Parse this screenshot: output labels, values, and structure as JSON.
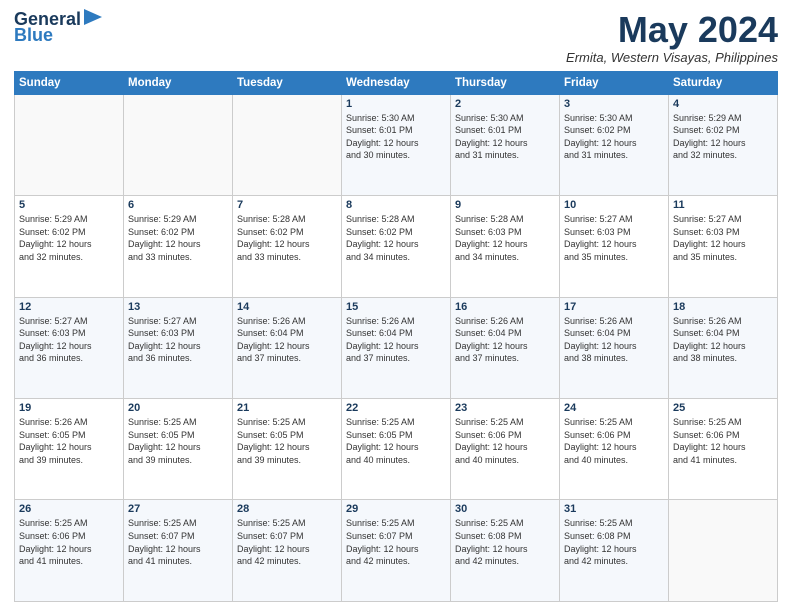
{
  "header": {
    "logo_line1": "General",
    "logo_line2": "Blue",
    "month_title": "May 2024",
    "location": "Ermita, Western Visayas, Philippines"
  },
  "weekdays": [
    "Sunday",
    "Monday",
    "Tuesday",
    "Wednesday",
    "Thursday",
    "Friday",
    "Saturday"
  ],
  "weeks": [
    [
      {
        "day": "",
        "info": ""
      },
      {
        "day": "",
        "info": ""
      },
      {
        "day": "",
        "info": ""
      },
      {
        "day": "1",
        "info": "Sunrise: 5:30 AM\nSunset: 6:01 PM\nDaylight: 12 hours\nand 30 minutes."
      },
      {
        "day": "2",
        "info": "Sunrise: 5:30 AM\nSunset: 6:01 PM\nDaylight: 12 hours\nand 31 minutes."
      },
      {
        "day": "3",
        "info": "Sunrise: 5:30 AM\nSunset: 6:02 PM\nDaylight: 12 hours\nand 31 minutes."
      },
      {
        "day": "4",
        "info": "Sunrise: 5:29 AM\nSunset: 6:02 PM\nDaylight: 12 hours\nand 32 minutes."
      }
    ],
    [
      {
        "day": "5",
        "info": "Sunrise: 5:29 AM\nSunset: 6:02 PM\nDaylight: 12 hours\nand 32 minutes."
      },
      {
        "day": "6",
        "info": "Sunrise: 5:29 AM\nSunset: 6:02 PM\nDaylight: 12 hours\nand 33 minutes."
      },
      {
        "day": "7",
        "info": "Sunrise: 5:28 AM\nSunset: 6:02 PM\nDaylight: 12 hours\nand 33 minutes."
      },
      {
        "day": "8",
        "info": "Sunrise: 5:28 AM\nSunset: 6:02 PM\nDaylight: 12 hours\nand 34 minutes."
      },
      {
        "day": "9",
        "info": "Sunrise: 5:28 AM\nSunset: 6:03 PM\nDaylight: 12 hours\nand 34 minutes."
      },
      {
        "day": "10",
        "info": "Sunrise: 5:27 AM\nSunset: 6:03 PM\nDaylight: 12 hours\nand 35 minutes."
      },
      {
        "day": "11",
        "info": "Sunrise: 5:27 AM\nSunset: 6:03 PM\nDaylight: 12 hours\nand 35 minutes."
      }
    ],
    [
      {
        "day": "12",
        "info": "Sunrise: 5:27 AM\nSunset: 6:03 PM\nDaylight: 12 hours\nand 36 minutes."
      },
      {
        "day": "13",
        "info": "Sunrise: 5:27 AM\nSunset: 6:03 PM\nDaylight: 12 hours\nand 36 minutes."
      },
      {
        "day": "14",
        "info": "Sunrise: 5:26 AM\nSunset: 6:04 PM\nDaylight: 12 hours\nand 37 minutes."
      },
      {
        "day": "15",
        "info": "Sunrise: 5:26 AM\nSunset: 6:04 PM\nDaylight: 12 hours\nand 37 minutes."
      },
      {
        "day": "16",
        "info": "Sunrise: 5:26 AM\nSunset: 6:04 PM\nDaylight: 12 hours\nand 37 minutes."
      },
      {
        "day": "17",
        "info": "Sunrise: 5:26 AM\nSunset: 6:04 PM\nDaylight: 12 hours\nand 38 minutes."
      },
      {
        "day": "18",
        "info": "Sunrise: 5:26 AM\nSunset: 6:04 PM\nDaylight: 12 hours\nand 38 minutes."
      }
    ],
    [
      {
        "day": "19",
        "info": "Sunrise: 5:26 AM\nSunset: 6:05 PM\nDaylight: 12 hours\nand 39 minutes."
      },
      {
        "day": "20",
        "info": "Sunrise: 5:25 AM\nSunset: 6:05 PM\nDaylight: 12 hours\nand 39 minutes."
      },
      {
        "day": "21",
        "info": "Sunrise: 5:25 AM\nSunset: 6:05 PM\nDaylight: 12 hours\nand 39 minutes."
      },
      {
        "day": "22",
        "info": "Sunrise: 5:25 AM\nSunset: 6:05 PM\nDaylight: 12 hours\nand 40 minutes."
      },
      {
        "day": "23",
        "info": "Sunrise: 5:25 AM\nSunset: 6:06 PM\nDaylight: 12 hours\nand 40 minutes."
      },
      {
        "day": "24",
        "info": "Sunrise: 5:25 AM\nSunset: 6:06 PM\nDaylight: 12 hours\nand 40 minutes."
      },
      {
        "day": "25",
        "info": "Sunrise: 5:25 AM\nSunset: 6:06 PM\nDaylight: 12 hours\nand 41 minutes."
      }
    ],
    [
      {
        "day": "26",
        "info": "Sunrise: 5:25 AM\nSunset: 6:06 PM\nDaylight: 12 hours\nand 41 minutes."
      },
      {
        "day": "27",
        "info": "Sunrise: 5:25 AM\nSunset: 6:07 PM\nDaylight: 12 hours\nand 41 minutes."
      },
      {
        "day": "28",
        "info": "Sunrise: 5:25 AM\nSunset: 6:07 PM\nDaylight: 12 hours\nand 42 minutes."
      },
      {
        "day": "29",
        "info": "Sunrise: 5:25 AM\nSunset: 6:07 PM\nDaylight: 12 hours\nand 42 minutes."
      },
      {
        "day": "30",
        "info": "Sunrise: 5:25 AM\nSunset: 6:08 PM\nDaylight: 12 hours\nand 42 minutes."
      },
      {
        "day": "31",
        "info": "Sunrise: 5:25 AM\nSunset: 6:08 PM\nDaylight: 12 hours\nand 42 minutes."
      },
      {
        "day": "",
        "info": ""
      }
    ]
  ]
}
